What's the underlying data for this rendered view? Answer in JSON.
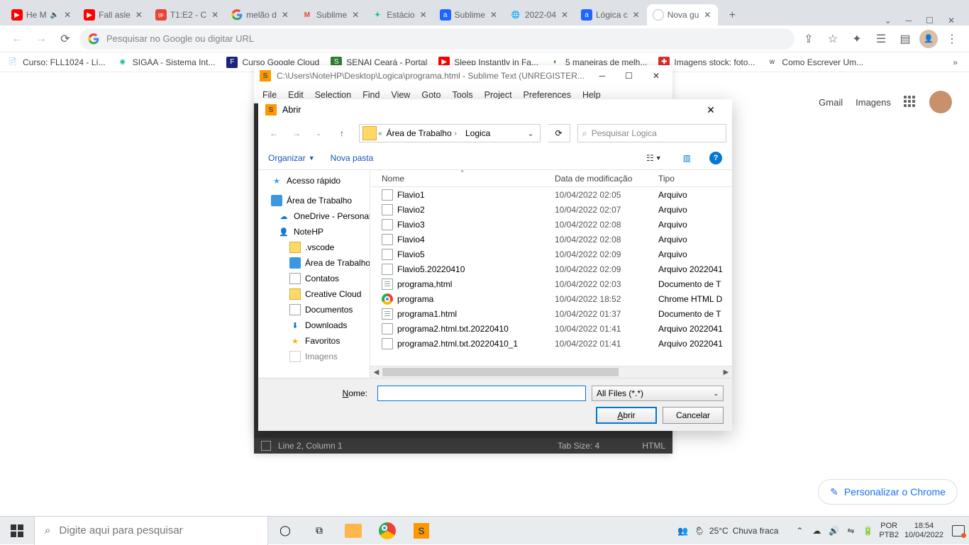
{
  "chrome": {
    "tabs": [
      {
        "title": "He M",
        "favicon": "youtube",
        "muted": true
      },
      {
        "title": "Fall asle",
        "favicon": "youtube"
      },
      {
        "title": "T1:E2 - C",
        "favicon": "globoplay"
      },
      {
        "title": "melão d",
        "favicon": "google"
      },
      {
        "title": "Sublime",
        "favicon": "gmail"
      },
      {
        "title": "Estácio",
        "favicon": "estacio"
      },
      {
        "title": "Sublime",
        "favicon": "alura"
      },
      {
        "title": "2022-04",
        "favicon": "globe"
      },
      {
        "title": "Lógica c",
        "favicon": "alura"
      },
      {
        "title": "Nova gu",
        "favicon": "blank",
        "active": true
      }
    ],
    "omnibox_placeholder": "Pesquisar no Google ou digitar URL",
    "bookmarks": [
      {
        "label": "Curso: FLL1024 - Lí...",
        "icon": "doc"
      },
      {
        "label": "SIGAA - Sistema Int...",
        "icon": "sigaa"
      },
      {
        "label": "Curso Google Cloud",
        "icon": "fiap"
      },
      {
        "label": "SENAI Ceará - Portal",
        "icon": "senai"
      },
      {
        "label": "Sleep Instantly in Fa...",
        "icon": "youtube"
      },
      {
        "label": "5 maneiras de melh...",
        "icon": "green"
      },
      {
        "label": "Imagens stock: foto...",
        "icon": "stock"
      },
      {
        "label": "Como Escrever Um...",
        "icon": "wiki"
      }
    ],
    "ntp": {
      "gmail": "Gmail",
      "images": "Imagens",
      "personalize": "Personalizar o Chrome"
    }
  },
  "sublime": {
    "title": "C:\\Users\\NoteHP\\Desktop\\Logica\\programa.html - Sublime Text (UNREGISTER...",
    "menu": [
      "File",
      "Edit",
      "Selection",
      "Find",
      "View",
      "Goto",
      "Tools",
      "Project",
      "Preferences",
      "Help"
    ],
    "status": {
      "pos": "Line 2, Column 1",
      "tab": "Tab Size: 4",
      "syntax": "HTML"
    }
  },
  "dialog": {
    "title": "Abrir",
    "crumb_mid": "Área de Trabalho",
    "crumb_leaf": "Logica",
    "search_placeholder": "Pesquisar Logica",
    "organize": "Organizar",
    "newfolder": "Nova pasta",
    "columns": {
      "name": "Nome",
      "date": "Data de modificação",
      "type": "Tipo"
    },
    "navtree": [
      "Acesso rápido",
      "Área de Trabalho",
      "OneDrive - Personal",
      "NoteHP",
      ".vscode",
      "Área de Trabalho",
      "Contatos",
      "Creative Cloud",
      "Documentos",
      "Downloads",
      "Favoritos",
      "Imagens"
    ],
    "files": [
      {
        "name": "Flavio1",
        "date": "10/04/2022 02:05",
        "type": "Arquivo",
        "icon": "file"
      },
      {
        "name": "Flavio2",
        "date": "10/04/2022 02:07",
        "type": "Arquivo",
        "icon": "file"
      },
      {
        "name": "Flavio3",
        "date": "10/04/2022 02:08",
        "type": "Arquivo",
        "icon": "file"
      },
      {
        "name": "Flavio4",
        "date": "10/04/2022 02:08",
        "type": "Arquivo",
        "icon": "file"
      },
      {
        "name": "Flavio5",
        "date": "10/04/2022 02:09",
        "type": "Arquivo",
        "icon": "file"
      },
      {
        "name": "Flavio5.20220410",
        "date": "10/04/2022 02:09",
        "type": "Arquivo 2022041",
        "icon": "file"
      },
      {
        "name": "programa,html",
        "date": "10/04/2022 02:03",
        "type": "Documento de T",
        "icon": "txt"
      },
      {
        "name": "programa",
        "date": "10/04/2022 18:52",
        "type": "Chrome HTML D",
        "icon": "chrome"
      },
      {
        "name": "programa1.html",
        "date": "10/04/2022 01:37",
        "type": "Documento de T",
        "icon": "txt"
      },
      {
        "name": "programa2.html.txt.20220410",
        "date": "10/04/2022 01:41",
        "type": "Arquivo 2022041",
        "icon": "file"
      },
      {
        "name": "programa2.html.txt.20220410_1",
        "date": "10/04/2022 01:41",
        "type": "Arquivo 2022041",
        "icon": "file"
      }
    ],
    "name_label": "Nome:",
    "filter": "All Files (*.*)",
    "open": "Abrir",
    "cancel": "Cancelar",
    "name_value": ""
  },
  "taskbar": {
    "search_placeholder": "Digite aqui para pesquisar",
    "weather_temp": "25°C",
    "weather_desc": "Chuva fraca",
    "lang_top": "POR",
    "lang_bot": "PTB2",
    "time": "18:54",
    "date": "10/04/2022"
  }
}
